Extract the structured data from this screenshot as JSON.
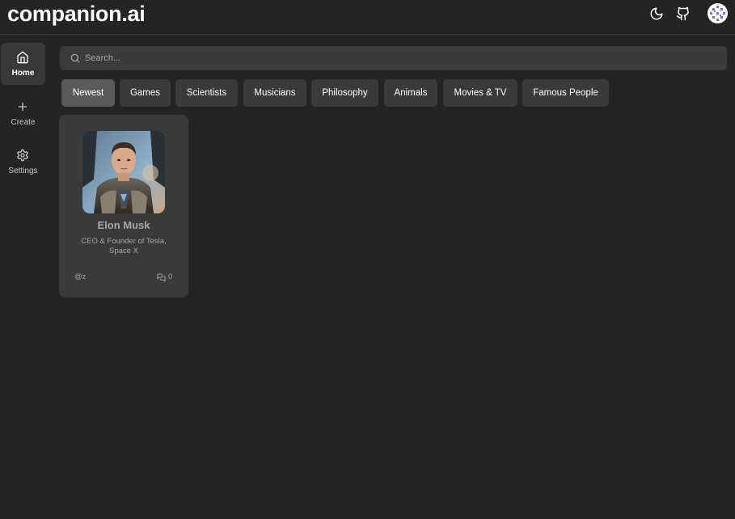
{
  "app": {
    "title": "companion.ai"
  },
  "header": {
    "icons": [
      "moon-icon",
      "github-icon",
      "user-avatar"
    ]
  },
  "sidebar": {
    "items": [
      {
        "label": "Home",
        "icon": "home-icon",
        "active": true
      },
      {
        "label": "Create",
        "icon": "plus-icon",
        "active": false
      },
      {
        "label": "Settings",
        "icon": "gear-icon",
        "active": false
      }
    ]
  },
  "search": {
    "placeholder": "Search...",
    "value": ""
  },
  "categories": [
    {
      "label": "Newest",
      "active": true
    },
    {
      "label": "Games",
      "active": false
    },
    {
      "label": "Scientists",
      "active": false
    },
    {
      "label": "Musicians",
      "active": false
    },
    {
      "label": "Philosophy",
      "active": false
    },
    {
      "label": "Animals",
      "active": false
    },
    {
      "label": "Movies & TV",
      "active": false
    },
    {
      "label": "Famous People",
      "active": false
    }
  ],
  "companions": [
    {
      "name": "Elon Musk",
      "description": "CEO & Founder of Tesla, Space X",
      "user": "@z",
      "chat_count": "0",
      "avatar": "portrait-image"
    }
  ],
  "colors": {
    "background": "#242424",
    "surface": "#3a3a3a",
    "active_chip": "#5a5a5a",
    "text": "#ffffff",
    "muted_text": "#a6a6a6"
  }
}
